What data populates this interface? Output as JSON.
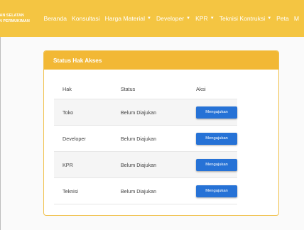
{
  "brand": {
    "line1": "ITAN SELATAN",
    "line2": "AN PERMUKIMAN"
  },
  "nav": {
    "items": [
      {
        "label": "Beranda",
        "dropdown": false
      },
      {
        "label": "Konsultasi",
        "dropdown": false
      },
      {
        "label": "Harga Material",
        "dropdown": true
      },
      {
        "label": "Developer",
        "dropdown": true
      },
      {
        "label": "KPR",
        "dropdown": true
      },
      {
        "label": "Teknisi Kontruksi",
        "dropdown": true
      },
      {
        "label": "Peta",
        "dropdown": false
      },
      {
        "label": "M",
        "dropdown": false
      }
    ]
  },
  "card": {
    "title": "Status Hak Akses",
    "columns": [
      "Hak",
      "Status",
      "Aksi"
    ],
    "rows": [
      {
        "hak": "Toko",
        "status": "Belum Diajukan",
        "action": "Mengajukan"
      },
      {
        "hak": "Developer",
        "status": "Belum Diajukan",
        "action": "Mengajukan"
      },
      {
        "hak": "KPR",
        "status": "Belum Diajukan",
        "action": "Mengajukan"
      },
      {
        "hak": "Teknisi",
        "status": "Belum Diajukan",
        "action": "Mengajukan"
      }
    ]
  },
  "colors": {
    "navbar": "#f4c542",
    "card_header": "#f2b835",
    "button": "#2672d6"
  }
}
